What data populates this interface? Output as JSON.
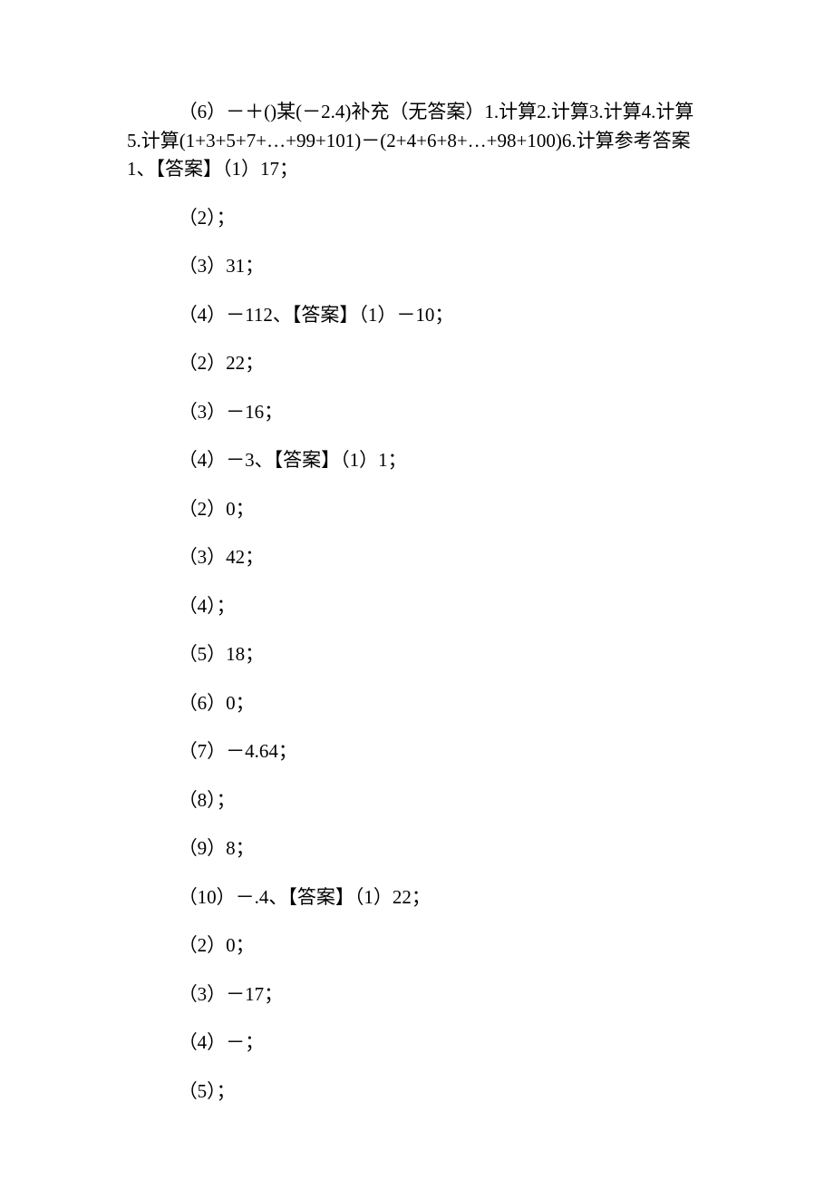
{
  "first": "（6）－＋()某(－2.4)补充（无答案）1.计算2.计算3.计算4.计算5.计算(1+3+5+7+…+99+101)－(2+4+6+8+…+98+100)6.计算参考答案1、【答案】（1）17；",
  "lines": [
    "（2）；",
    "（3）31；",
    "（4）－112、【答案】（1）－10；",
    "（2）22；",
    "（3）－16；",
    "（4）－3、【答案】（1）1；",
    "（2）0；",
    "（3）42；",
    "（4）；",
    "（5）18；",
    "（6）0；",
    "（7）－4.64；",
    "（8）；",
    "（9）8；",
    "（10）－.4、【答案】（1）22；",
    "（2）0；",
    "（3）－17；",
    "（4）－；",
    "（5）；"
  ]
}
